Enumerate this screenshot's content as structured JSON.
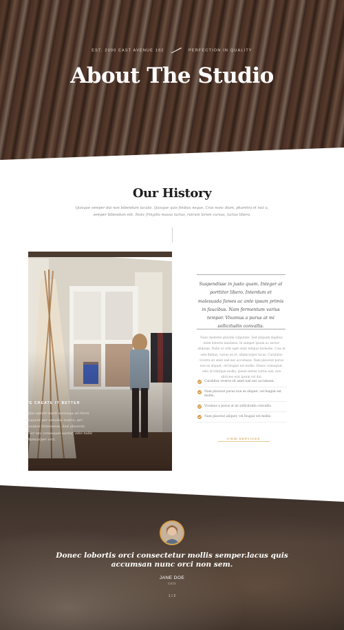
{
  "hero": {
    "meta_left": "EST. 2000 EAST AVENUE 192",
    "meta_right": "PERFECTION IN QUALITY",
    "quill_icon": "quill-pen-icon",
    "title": "About The Studio"
  },
  "history": {
    "title": "Our History",
    "subtitle": "Quisque semper dui non bibendum iaculis. Quisque quis finibus neque. Cras nunc diam, pharetra et nisl a, semper bibendum elit. Nunc fringilla massa luctus, rutrum lorem cursus, luctus libero.",
    "photo_label": "WE CREATE IT BETTER",
    "photo_text": "Class aptent taciti sociosqu ad litora torquent per conubia nostra, per inceptos himenaeos. Sed placerat, dolor nec consequat auctor, odio nulla ullamcorper orci.",
    "quote": "Suspendisse in justo quam. Integer at porttitor libero. Interdum et malesuada fames ac ante ipsum primis in faucibus. Nam fermentum varius tempor. Vivamus a purus at mi sollicitudin convallis.",
    "body": "Nunc molestie gravida vulputate. Sed aliquam dapibus enim lobortis maximus. In semper ipsum ac auctor aliquam. Nulla ut velit eget enim tempus molestie. Cras in sem finibus, varius ex et, ullamcorper lacus. Curabitur viverra sit amet nisl nec accumsan. Nam placerat purus non ex aliquet, vel feugiat est mollis. Donec consequat, odio id tristique mollis, ipsum metus varius nisi, non ultricies erat ipsum vel dui.",
    "list": [
      "Curabitur viverra sit amet nisl nec accumsan.",
      "Nam placerat purus non ex aliquet, vel feugiat est mollis.",
      "Vivamus a purus at mi sollicitudin convallis.",
      "Nam placerat aliquet, vel feugiat est mollis."
    ],
    "services_link": "VIEW SERVICES",
    "accent_color": "#c79237"
  },
  "testimonial": {
    "quote": "Donec lobortis orci consectetur mollis semper.lacus quis accumsan nunc orci non sem.",
    "name": "JANE DOE",
    "role": "CEO",
    "pager": "1 / 2"
  }
}
